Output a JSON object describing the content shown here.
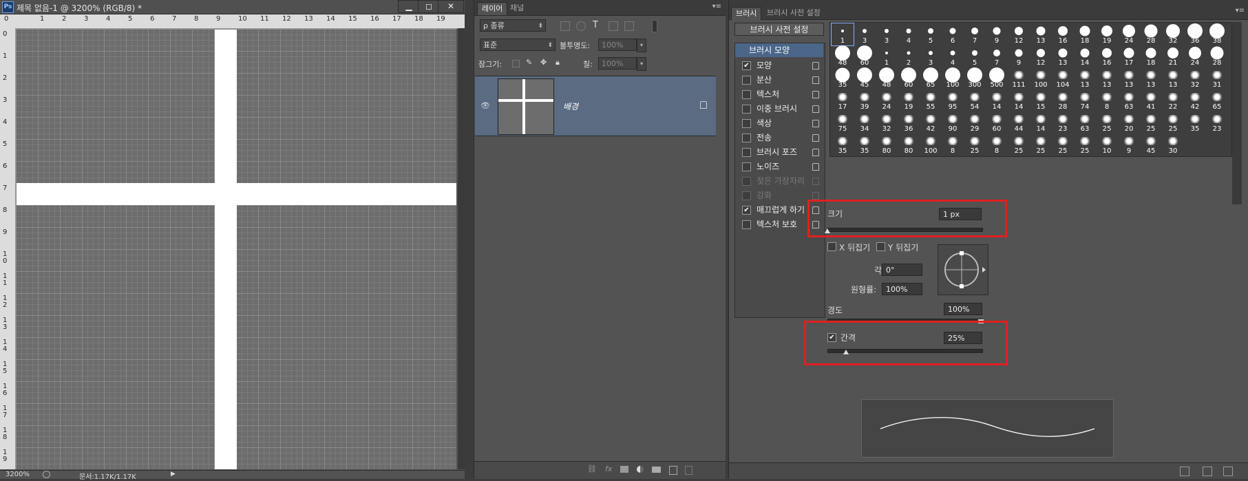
{
  "document": {
    "title": "제목 없음-1 @ 3200% (RGB/8) *",
    "ps_logo": "Ps",
    "window_buttons": [
      "▁",
      "◻",
      "✕"
    ],
    "ruler_top": [
      "0",
      "1",
      "2",
      "3",
      "4",
      "5",
      "6",
      "7",
      "8",
      "9",
      "10",
      "11",
      "12",
      "13",
      "14",
      "15",
      "16",
      "17",
      "18",
      "19"
    ],
    "ruler_left": [
      "0",
      "1",
      "2",
      "3",
      "4",
      "5",
      "6",
      "7",
      "8",
      "9",
      "10",
      "11",
      "12",
      "13",
      "14",
      "15",
      "16",
      "17",
      "18",
      "19"
    ],
    "zoom": "3200%",
    "doc_info": "문서:1.17K/1.17K"
  },
  "layers_panel": {
    "tabs": [
      "레이어",
      "채널"
    ],
    "filter_kind": "ρ 종류",
    "blend_mode": "표준",
    "opacity_label": "불투명도:",
    "opacity_value": "100%",
    "lock_label": "잠그기:",
    "fill_label": "칠:",
    "fill_value": "100%",
    "layer_name": "배경",
    "footer_icons": [
      "link-icon",
      "fx-icon",
      "mask-icon",
      "adjustment-icon",
      "folder-icon",
      "new-layer-icon",
      "trash-icon"
    ]
  },
  "brush_panel": {
    "tabs": [
      "브러시",
      "브러시 사전 설정"
    ],
    "preset_button": "브러시 사전 설정",
    "list_header": "브러시 모양",
    "options": [
      {
        "label": "모양",
        "checked": true,
        "enabled": true
      },
      {
        "label": "분산",
        "checked": false,
        "enabled": true
      },
      {
        "label": "텍스처",
        "checked": false,
        "enabled": true
      },
      {
        "label": "이중 브러시",
        "checked": false,
        "enabled": true
      },
      {
        "label": "색상",
        "checked": false,
        "enabled": true
      },
      {
        "label": "전송",
        "checked": false,
        "enabled": true
      },
      {
        "label": "브러시 포즈",
        "checked": false,
        "enabled": true
      },
      {
        "label": "노이즈",
        "checked": false,
        "enabled": true
      },
      {
        "label": "젖은 가장자리",
        "checked": false,
        "enabled": false
      },
      {
        "label": "강화",
        "checked": false,
        "enabled": false
      },
      {
        "label": "매끄럽게 하기",
        "checked": true,
        "enabled": true
      },
      {
        "label": "텍스처 보호",
        "checked": false,
        "enabled": true
      }
    ],
    "preset_rows": [
      [
        "1",
        "3",
        "3",
        "4",
        "5",
        "6",
        "7",
        "9",
        "12",
        "13",
        "16",
        "18",
        "19",
        "24",
        "28",
        "32",
        "36",
        "38"
      ],
      [
        "48",
        "60",
        "1",
        "2",
        "3",
        "4",
        "5",
        "7",
        "9",
        "12",
        "13",
        "14",
        "16",
        "17",
        "18",
        "21",
        "24",
        "28"
      ],
      [
        "35",
        "45",
        "48",
        "60",
        "65",
        "100",
        "300",
        "500",
        "111",
        "100",
        "104",
        "13",
        "13",
        "13",
        "13",
        "13",
        "32",
        "31"
      ],
      [
        "17",
        "39",
        "24",
        "19",
        "55",
        "95",
        "54",
        "14",
        "14",
        "15",
        "28",
        "74",
        "8",
        "63",
        "41",
        "22",
        "42",
        "65"
      ],
      [
        "75",
        "34",
        "32",
        "36",
        "42",
        "90",
        "29",
        "60",
        "44",
        "14",
        "23",
        "63",
        "25",
        "20",
        "25",
        "25",
        "35",
        "23"
      ],
      [
        "35",
        "35",
        "80",
        "80",
        "100",
        "8",
        "25",
        "8",
        "25",
        "25",
        "25",
        "25",
        "10",
        "9",
        "45",
        "30"
      ]
    ],
    "size_label": "크기",
    "size_value": "1 px",
    "flip_x": "X 뒤집기",
    "flip_y": "Y 뒤집기",
    "angle_label": "각도:",
    "angle_value": "0°",
    "roundness_label": "원형률:",
    "roundness_value": "100%",
    "hardness_label": "경도",
    "hardness_value": "100%",
    "spacing_label": "간격",
    "spacing_checked": true,
    "spacing_value": "25%",
    "highlight_color": "#e02020"
  }
}
